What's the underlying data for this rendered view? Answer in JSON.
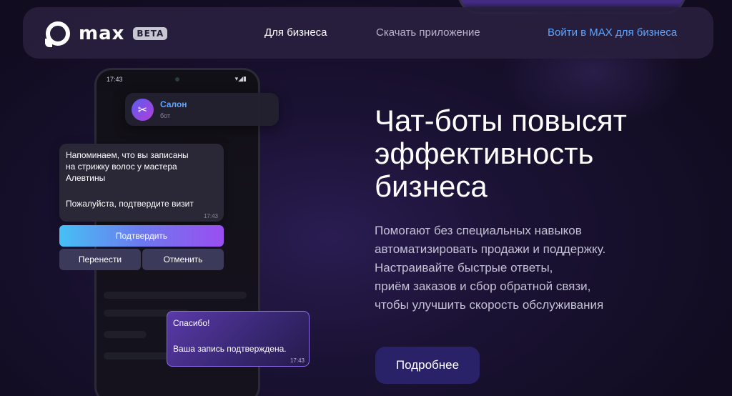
{
  "header": {
    "logo_text": "max",
    "beta_badge": "BETA",
    "nav_business": "Для бизнеса",
    "nav_download": "Скачать приложение",
    "login_link": "Войти в MAX для бизнеса"
  },
  "phone": {
    "time": "17:43",
    "status": "▾◢▮"
  },
  "salon": {
    "name": "Салон",
    "subtitle": "бот",
    "avatar_icon": "scissors-icon",
    "avatar_glyph": "✂"
  },
  "reminder": {
    "text": "Напоминаем, что вы записаны\nна стрижку волос у мастера\nАлевтины",
    "ask": "Пожалуйста, подтвердите визит",
    "time": "17:43"
  },
  "actions": {
    "confirm": "Подтвердить",
    "reschedule": "Перенести",
    "cancel": "Отменить"
  },
  "thanks": {
    "line1": "Спасибо!",
    "line2": "Ваша запись подтверждена.",
    "time": "17:43"
  },
  "hero": {
    "title_lines": [
      "Чат-боты повысят",
      "эффективность",
      "бизнеса"
    ],
    "desc_lines": [
      "Помогают без специальных навыков",
      "автоматизировать продажи и поддержку.",
      "Настраивайте быстрые ответы,",
      "приём заказов и сбор обратной связи,",
      "чтобы улучшить скорость обслуживания"
    ],
    "cta": "Подробнее"
  },
  "colors": {
    "accent_blue": "#5ea6ff",
    "cta_bg": "#2a2268"
  }
}
